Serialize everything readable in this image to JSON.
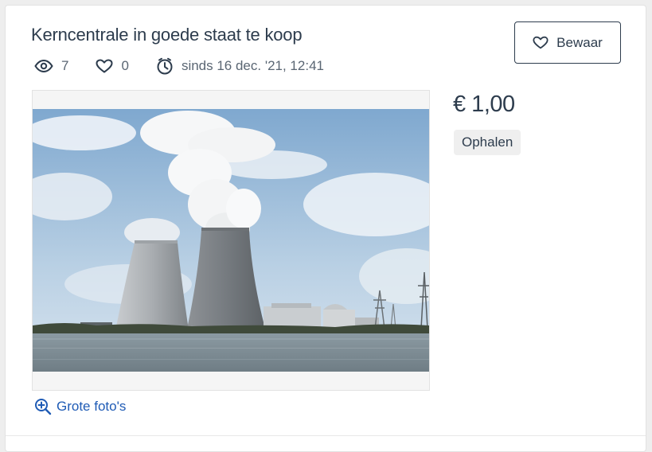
{
  "listing": {
    "title": "Kerncentrale in goede staat te koop",
    "views": "7",
    "favorites": "0",
    "since": "sinds 16 dec. '21, 12:41",
    "price": "€ 1,00",
    "delivery_tag": "Ophalen"
  },
  "actions": {
    "save_label": "Bewaar",
    "big_photos_label": "Grote foto's"
  },
  "icons": {
    "views": "eye-icon",
    "favorites": "heart-icon",
    "since": "clock-icon",
    "save": "heart-icon",
    "zoom": "zoom-in-icon"
  },
  "colors": {
    "text": "#2d3c4d",
    "link": "#1f5bb5",
    "muted": "#5a6673"
  }
}
